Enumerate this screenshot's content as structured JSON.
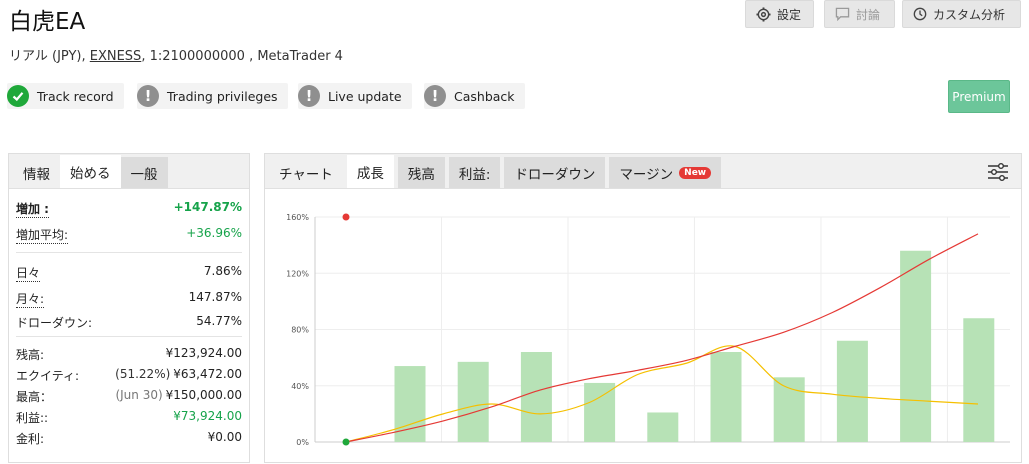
{
  "header": {
    "title": "白虎EA",
    "subtitle_prefix": "リアル (JPY), ",
    "broker": "EXNESS",
    "subtitle_suffix": ", 1:2100000000 , MetaTrader 4",
    "buttons": {
      "settings": "設定",
      "discuss": "討論",
      "custom_analysis": "カスタム分析"
    }
  },
  "badges": [
    {
      "label": "Track record",
      "status": "ok"
    },
    {
      "label": "Trading privileges",
      "status": "warn"
    },
    {
      "label": "Live update",
      "status": "warn"
    },
    {
      "label": "Cashback",
      "status": "warn"
    }
  ],
  "premium_label": "Premium",
  "left_panel": {
    "tabs": [
      "情報",
      "始める",
      "一般"
    ],
    "rows": {
      "gain": {
        "label": "増加 :",
        "value": "+147.87%"
      },
      "avg_gain": {
        "label": "増加平均:",
        "value": "+36.96%"
      },
      "daily": {
        "label": "日々",
        "value": "7.86%"
      },
      "monthly": {
        "label": "月々:",
        "value": "147.87%"
      },
      "drawdown": {
        "label": "ドローダウン:",
        "value": "54.77%"
      },
      "balance": {
        "label": "残高:",
        "value": "¥123,924.00"
      },
      "equity": {
        "label": "エクイティ:",
        "note": "(51.22%)",
        "value": "¥63,472.00"
      },
      "highest": {
        "label": "最高：",
        "note": "(Jun 30)",
        "value": "¥150,000.00"
      },
      "profit": {
        "label": "利益::",
        "value": "¥73,924.00"
      },
      "interest": {
        "label": "金利:",
        "value": "¥0.00"
      }
    }
  },
  "right_panel": {
    "tabs": [
      "チャート",
      "成長",
      "残高",
      "利益:",
      "ドローダウン",
      "マージン"
    ],
    "new_badge": "New"
  },
  "chart_data": {
    "type": "bar",
    "ylim": [
      0,
      160
    ],
    "yticks": [
      "0%",
      "40%",
      "80%",
      "120%",
      "160%"
    ],
    "bars": [
      54,
      57,
      64,
      42,
      21,
      64,
      46,
      72,
      136,
      88
    ],
    "series": [
      {
        "color": "#e53935",
        "values": [
          0,
          7,
          15,
          25,
          37,
          45,
          51,
          58,
          68,
          78,
          92,
          110,
          130,
          148
        ]
      },
      {
        "color": "#f5c000",
        "values": [
          0,
          9,
          20,
          27,
          20,
          28,
          48,
          56,
          68,
          40,
          34,
          31,
          29,
          27
        ]
      }
    ],
    "colors": {
      "bar": "#b7e2b6",
      "axis": "#cccccc",
      "grid": "#eeeeee"
    }
  }
}
